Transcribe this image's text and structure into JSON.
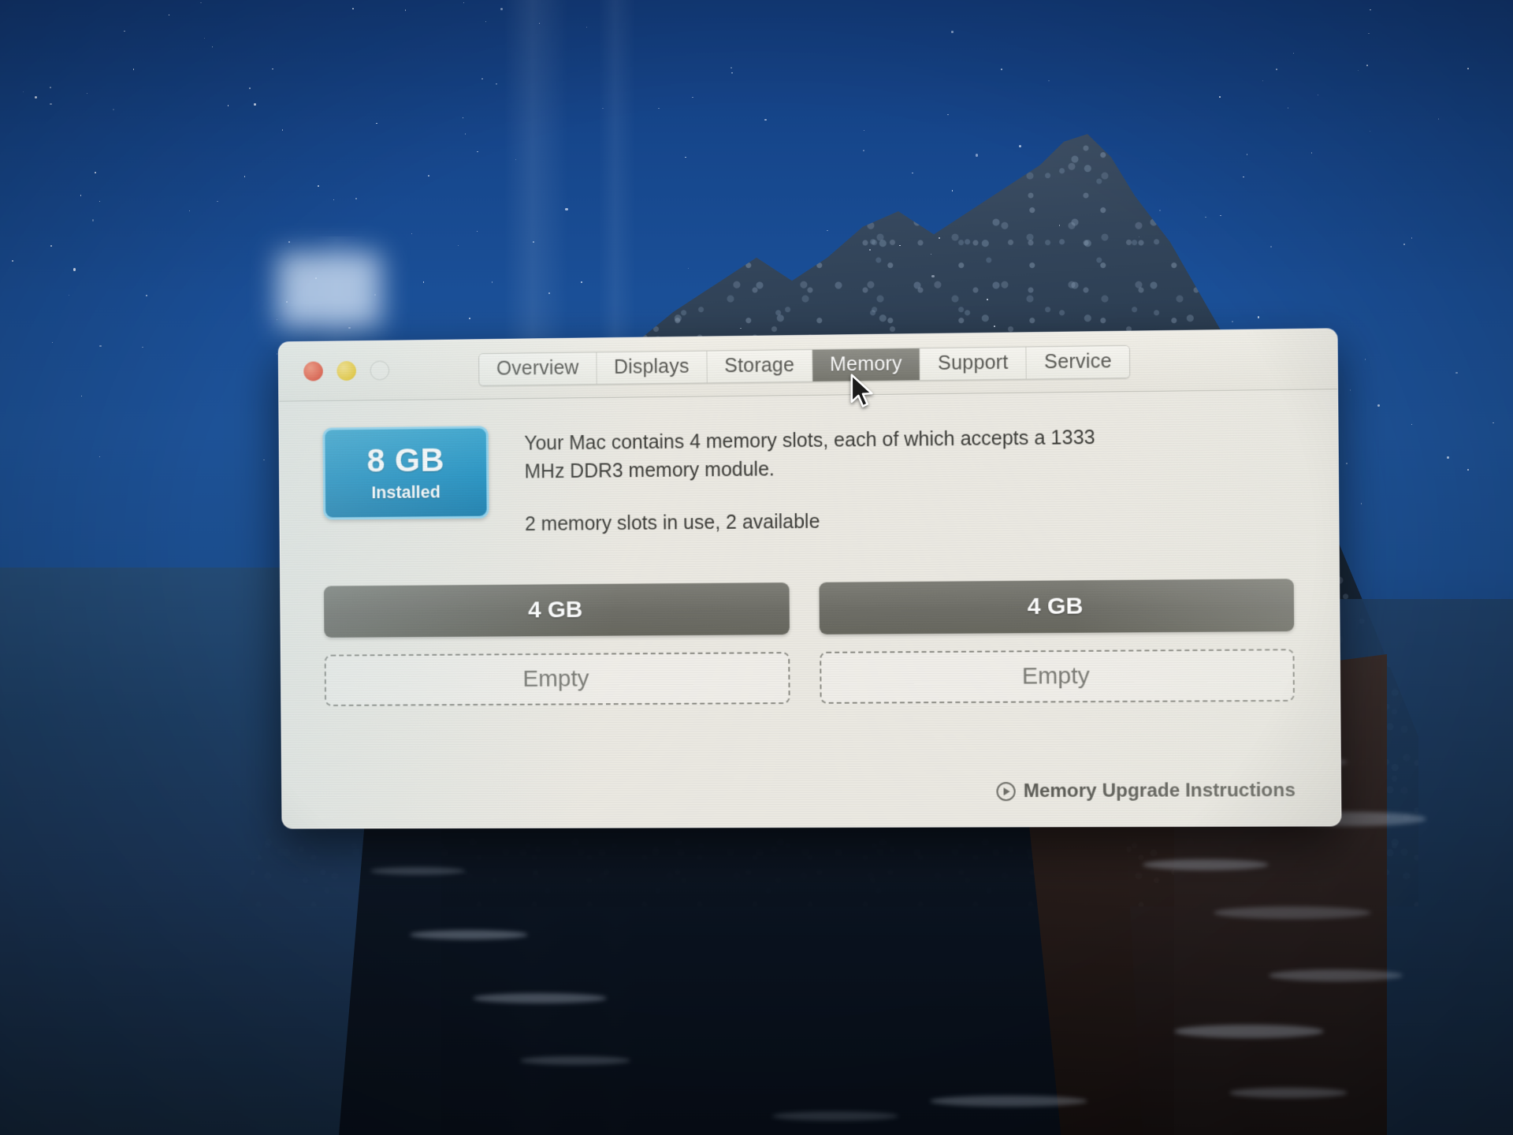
{
  "window": {
    "traffic_lights": [
      {
        "name": "close",
        "color": "#e8452a"
      },
      {
        "name": "minimize",
        "color": "#efc925"
      },
      {
        "name": "zoom",
        "color": "#c9c9c2"
      }
    ],
    "tabs": [
      {
        "label": "Overview",
        "active": false
      },
      {
        "label": "Displays",
        "active": false
      },
      {
        "label": "Storage",
        "active": false
      },
      {
        "label": "Memory",
        "active": true
      },
      {
        "label": "Support",
        "active": false
      },
      {
        "label": "Service",
        "active": false
      }
    ]
  },
  "memory": {
    "badge": {
      "amount": "8 GB",
      "status": "Installed",
      "accent_color": "#1b8fc2"
    },
    "description_line_1": "Your Mac contains 4 memory slots, each of which accepts a 1333 MHz DDR3 memory module.",
    "description_line_2": "2 memory slots in use, 2 available",
    "slots": [
      {
        "label": "4 GB",
        "state": "filled"
      },
      {
        "label": "4 GB",
        "state": "filled"
      },
      {
        "label": "Empty",
        "state": "empty"
      },
      {
        "label": "Empty",
        "state": "empty"
      }
    ]
  },
  "footer": {
    "link_label": "Memory Upgrade Instructions",
    "link_icon": "circle-arrow-right-icon"
  },
  "cursor": {
    "icon": "arrow-pointer-icon"
  }
}
